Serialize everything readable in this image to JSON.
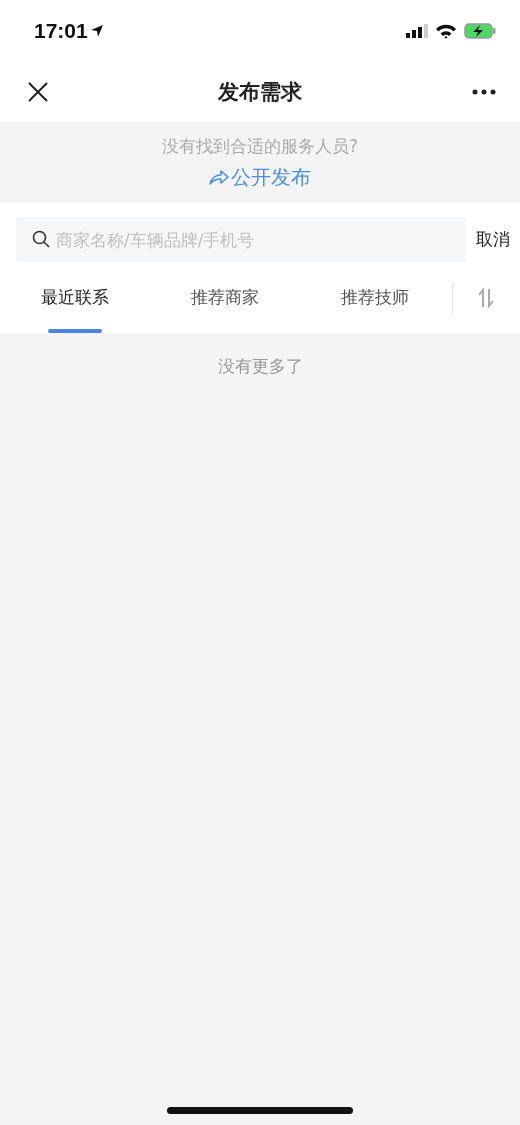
{
  "status_bar": {
    "time": "17:01"
  },
  "nav_bar": {
    "title": "发布需求"
  },
  "banner": {
    "question": "没有找到合适的服务人员?",
    "link": "公开发布"
  },
  "search": {
    "placeholder": "商家名称/车辆品牌/手机号",
    "cancel": "取消"
  },
  "tabs": [
    {
      "label": "最近联系",
      "selected": true
    },
    {
      "label": "推荐商家",
      "selected": false
    },
    {
      "label": "推荐技师",
      "selected": false
    }
  ],
  "list": {
    "end_message": "没有更多了"
  }
}
